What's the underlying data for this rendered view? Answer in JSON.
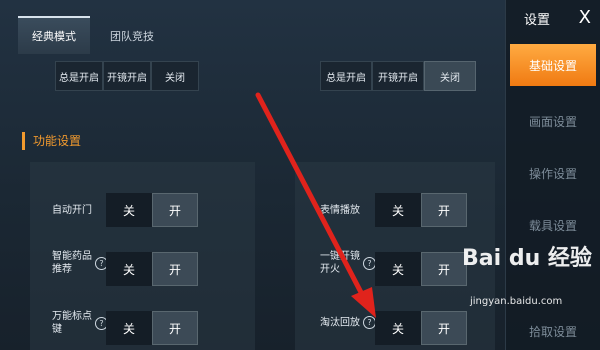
{
  "tabs": [
    {
      "label": "经典模式",
      "active": true
    },
    {
      "label": "团队竞技",
      "active": false
    }
  ],
  "right_panel": {
    "title": "设置",
    "close": "X",
    "items": [
      {
        "label": "基础设置",
        "active": true
      },
      {
        "label": "画面设置",
        "active": false
      },
      {
        "label": "操作设置",
        "active": false
      },
      {
        "label": "载具设置",
        "active": false
      },
      {
        "label": "",
        "active": false
      },
      {
        "label": "拾取设置",
        "active": false
      }
    ]
  },
  "top_options": {
    "left": [
      "总是开启",
      "开镜开启",
      "关闭"
    ],
    "right": [
      "总是开启",
      "开镜开启",
      "关闭"
    ]
  },
  "section_title": "功能设置",
  "settings_left": [
    {
      "label": "自动开门",
      "help": false,
      "off": "关",
      "on": "开"
    },
    {
      "label": "智能药品\n推荐",
      "help": true,
      "off": "关",
      "on": "开"
    },
    {
      "label": "万能标点\n键",
      "help": true,
      "off": "关",
      "on": "开"
    }
  ],
  "settings_right": [
    {
      "label": "表情播放",
      "help": false,
      "off": "关",
      "on": "开"
    },
    {
      "label": "一键开镜\n开火",
      "help": true,
      "off": "关",
      "on": "开"
    },
    {
      "label": "淘汰回放",
      "help": true,
      "off": "关",
      "on": "开"
    }
  ],
  "help_glyph": "?",
  "watermark": {
    "logo": "Bai du 经验",
    "url": "jingyan.baidu.com"
  },
  "colors": {
    "accent": "#f29a2e",
    "active_tab": "#f58a1f",
    "arrow": "#e0231c"
  }
}
